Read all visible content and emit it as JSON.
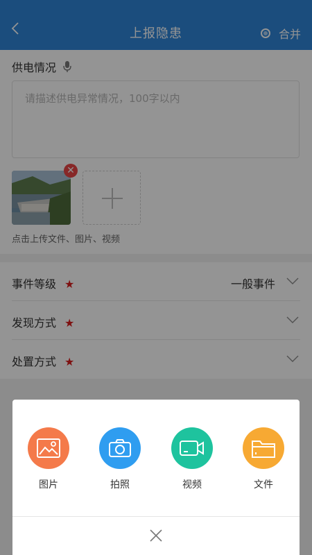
{
  "header": {
    "title": "上报隐患",
    "merge_label": "合并"
  },
  "power": {
    "label": "供电情况",
    "placeholder": "请描述供电异常情况，100字以内",
    "upload_hint": "点击上传文件、图片、视频"
  },
  "fields": [
    {
      "label": "事件等级",
      "required": "★",
      "value": "一般事件"
    },
    {
      "label": "发现方式",
      "required": "★",
      "value": ""
    },
    {
      "label": "处置方式",
      "required": "★",
      "value": ""
    }
  ],
  "sheet": {
    "options": [
      {
        "label": "图片",
        "icon": "image-icon",
        "color": "#f47a4a"
      },
      {
        "label": "拍照",
        "icon": "camera-icon",
        "color": "#2f9df0"
      },
      {
        "label": "视频",
        "icon": "video-icon",
        "color": "#1ec39e"
      },
      {
        "label": "文件",
        "icon": "folder-icon",
        "color": "#f7a933"
      }
    ]
  }
}
